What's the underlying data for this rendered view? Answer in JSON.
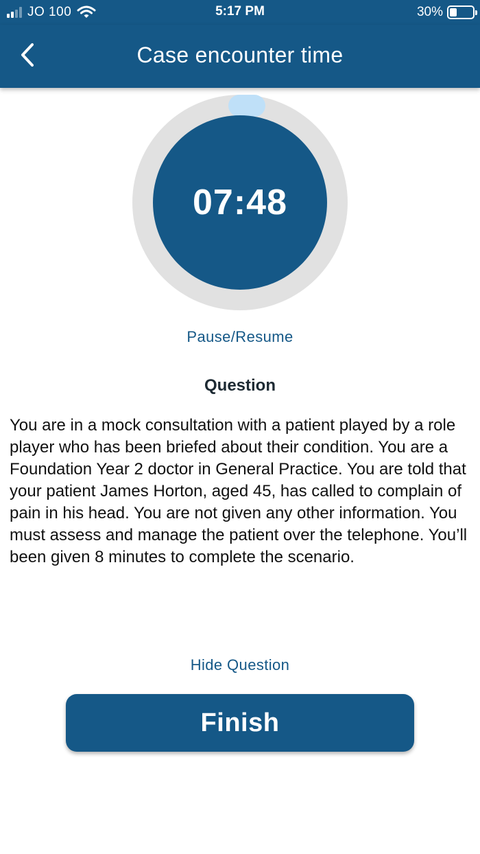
{
  "status_bar": {
    "carrier": "JO 100",
    "time": "5:17 PM",
    "battery_percent": "30%",
    "battery_level": 0.3,
    "signal_bars_active": 2,
    "signal_bars_total": 4
  },
  "nav": {
    "title": "Case encounter time",
    "back_icon": "chevron-left-icon"
  },
  "timer": {
    "display": "07:48",
    "ring_color": "#e1e1e1",
    "knob_color": "#bfe0f8",
    "inner_color": "#155887"
  },
  "controls": {
    "pause_resume_label": "Pause/Resume",
    "hide_question_label": "Hide Question",
    "finish_label": "Finish"
  },
  "question": {
    "heading": "Question",
    "body": "You are in a mock consultation with a patient played by a role player who has been briefed about their condition. You are a Foundation Year 2 doctor in General Practice. You are told that your patient James Horton, aged 45, has called to complain of pain in his head. You are not given any other information. You must assess and manage the patient over the telephone. You’ll been given 8 minutes to complete the scenario."
  },
  "colors": {
    "primary": "#155887",
    "background": "#ffffff",
    "text": "#111111"
  }
}
